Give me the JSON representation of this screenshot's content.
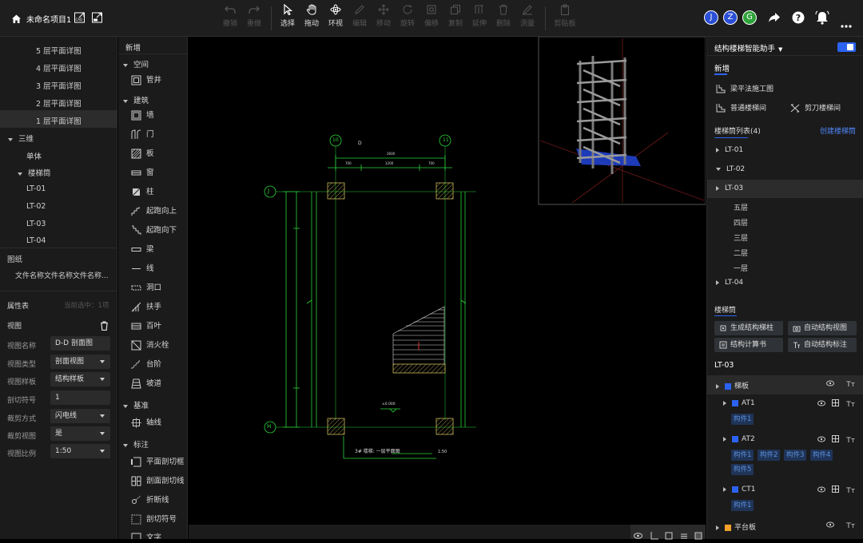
{
  "header": {
    "project_name": "未命名项目1",
    "tools": [
      {
        "name": "undo",
        "label": "撤销",
        "enabled": false
      },
      {
        "name": "redo",
        "label": "重做",
        "enabled": false
      },
      {
        "name": "select",
        "label": "选择",
        "enabled": true
      },
      {
        "name": "pan",
        "label": "拖动",
        "enabled": true
      },
      {
        "name": "orbit",
        "label": "环视",
        "enabled": true
      },
      {
        "name": "edit",
        "label": "编辑",
        "enabled": false
      },
      {
        "name": "move",
        "label": "移动",
        "enabled": false
      },
      {
        "name": "rotate",
        "label": "旋转",
        "enabled": false
      },
      {
        "name": "offset",
        "label": "偏移",
        "enabled": false
      },
      {
        "name": "copy",
        "label": "复制",
        "enabled": false
      },
      {
        "name": "extend",
        "label": "延伸",
        "enabled": false
      },
      {
        "name": "delete",
        "label": "删除",
        "enabled": false
      },
      {
        "name": "measure",
        "label": "测量",
        "enabled": false
      },
      {
        "name": "clipboard",
        "label": "剪贴板",
        "enabled": false
      }
    ],
    "avatars": [
      {
        "letter": "J",
        "color": "#2b4fd6"
      },
      {
        "letter": "Z",
        "color": "#2b4fd6"
      },
      {
        "letter": "G",
        "color": "#2fa33a"
      }
    ]
  },
  "left": {
    "floors": [
      "5 层平面详图",
      "4 层平面详图",
      "3 层平面详图",
      "2 层平面详图",
      "1 层平面详图"
    ],
    "three_d": "三维",
    "single": "单体",
    "stairwell": "楼梯筒",
    "stairs": [
      "LT-01",
      "LT-02",
      "LT-03",
      "LT-04"
    ],
    "drawings_title": "图纸",
    "drawing_file": "文件名称文件名称文件名称...",
    "props_title": "属性表",
    "props_hint": "当前选中：1项",
    "view_label": "视图",
    "props": [
      {
        "label": "视图名称",
        "value": "D-D 剖面图",
        "dropdown": false
      },
      {
        "label": "视图类型",
        "value": "剖面视图",
        "dropdown": true
      },
      {
        "label": "视图样板",
        "value": "结构样板",
        "dropdown": true
      },
      {
        "label": "剖切符号",
        "value": "1",
        "dropdown": false
      },
      {
        "label": "裁剪方式",
        "value": "闪电线",
        "dropdown": true
      },
      {
        "label": "裁剪视图",
        "value": "是",
        "dropdown": true
      },
      {
        "label": "视图比例",
        "value": "1:50",
        "dropdown": true
      }
    ]
  },
  "middle": {
    "title": "新增",
    "cat_space": "空间",
    "shaft": "管井",
    "cat_building": "建筑",
    "building_items": [
      "墙",
      "门",
      "板",
      "窗",
      "柱",
      "起跑向上",
      "起跑向下",
      "梁",
      "线",
      "洞口",
      "扶手",
      "百叶",
      "消火栓",
      "台阶",
      "坡道"
    ],
    "cat_datum": "基准",
    "axis": "轴线",
    "cat_annotation": "标注",
    "annotation_items": [
      "平面剖切框",
      "剖面剖切线",
      "折断线",
      "剖切符号"
    ],
    "partial": "文字"
  },
  "canvas": {
    "grid_top_left": "10",
    "grid_top_right": "11",
    "grid_left_top": "J",
    "grid_left_bottom": "H",
    "drawing_caption": "3# 楼梯: 一层平面图",
    "drawing_scale": "1:50",
    "level_mark": "±0.000",
    "grid_marker": "D",
    "dim_top": "2600",
    "dim_sub_1": "700",
    "dim_sub_2": "1200",
    "dim_sub_3": "700"
  },
  "right": {
    "assistant_title": "结构楼梯智能助手",
    "new_section": "新增",
    "beam_flat": "梁平法施工图",
    "normal_stair": "普通楼梯间",
    "scissor_stair": "剪刀楼梯间",
    "stair_list": "楼梯筒列表(4)",
    "create_stair": "创建楼梯筒",
    "stairs": [
      "LT-01",
      "LT-02",
      "LT-03",
      "LT-04"
    ],
    "lt03_floors": [
      "五层",
      "四层",
      "三层",
      "二层",
      "一层"
    ],
    "stairwell_section": "楼梯筒",
    "buttons": [
      "生成结构梯柱",
      "自动结构视图",
      "结构计算书",
      "自动结构标注"
    ],
    "current": "LT-03",
    "slab_label": "梯板",
    "at1": "AT1",
    "at1_parts": [
      "构件1"
    ],
    "at2": "AT2",
    "at2_parts": [
      "构件1",
      "构件2",
      "构件3",
      "构件4",
      "构件5"
    ],
    "ct1": "CT1",
    "ct1_parts": [
      "构件1"
    ],
    "platform": "平台板",
    "accent": "#2b62f0"
  }
}
